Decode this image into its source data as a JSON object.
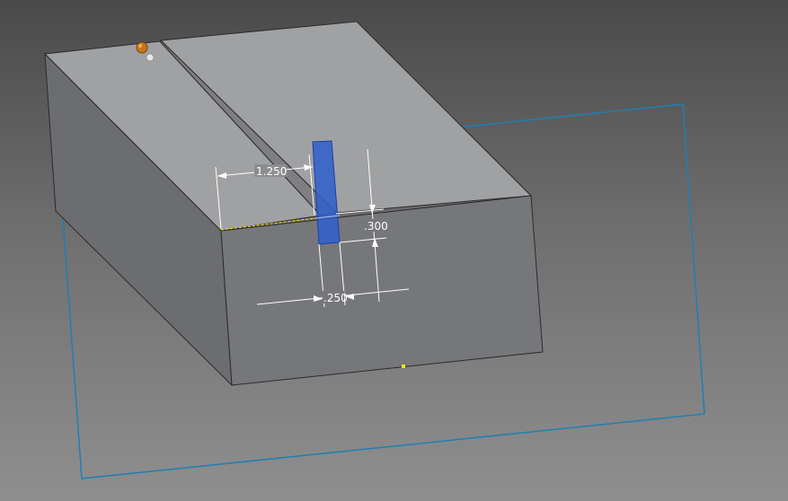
{
  "viewport": {
    "background_top": "#4a4a4a",
    "background_bottom": "#8f8f8f"
  },
  "model": {
    "top_face_color": "#a0a1a3",
    "side_face_color": "#6c6d70",
    "front_face_color": "#76777a",
    "edge_color": "#2b2b2b"
  },
  "sketch": {
    "plane_color": "#1f7fb4",
    "profile_color": "#2f5fcc",
    "dimension_color": "#ffffff",
    "point_color": "#ffe600"
  },
  "dimensions": {
    "slot_offset": "1.250",
    "slot_depth": ".300",
    "slot_width": ".250"
  },
  "icons": {
    "sketch_origin": "origin-marker-icon"
  }
}
